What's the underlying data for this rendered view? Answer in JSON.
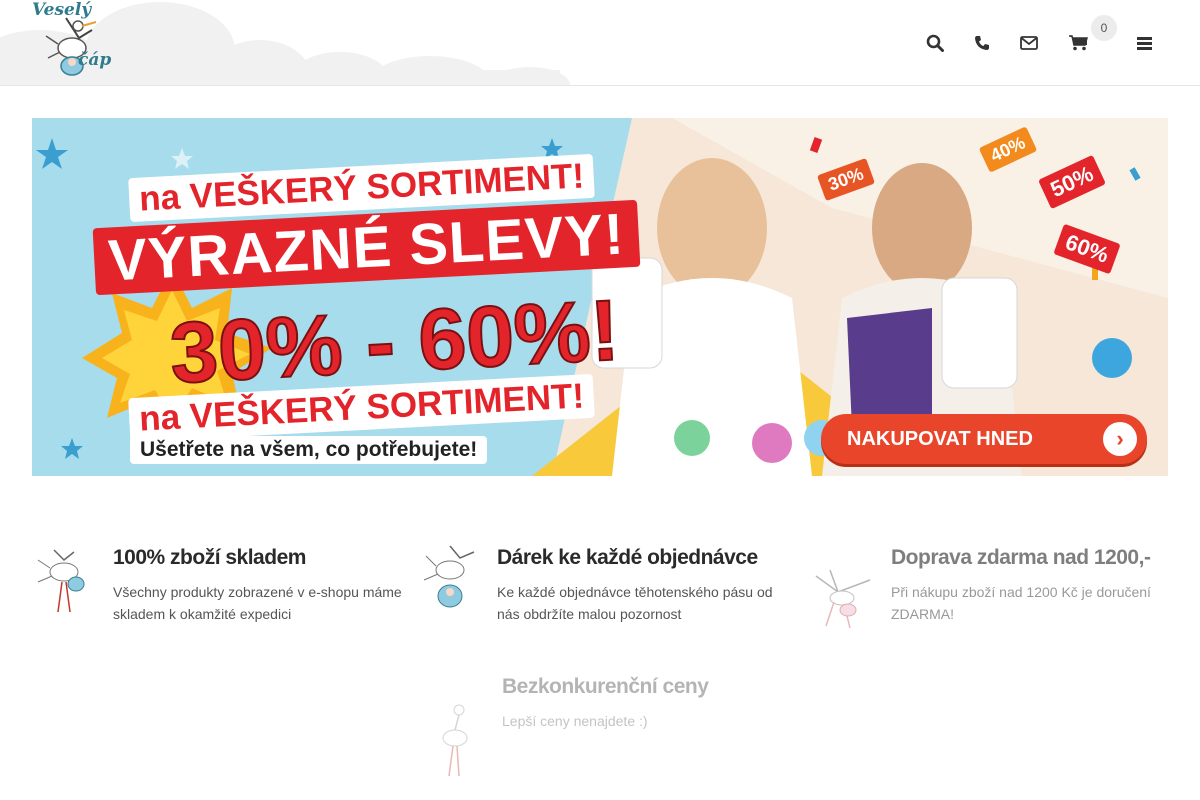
{
  "header": {
    "logo_text_top": "Veselý",
    "logo_text_bottom": "čáp",
    "cart_count": "0",
    "icons": [
      "search-icon",
      "phone-icon",
      "envelope-icon",
      "cart-icon",
      "menu-icon"
    ]
  },
  "banner": {
    "line1": "na VEŠKERÝ SORTIMENT!",
    "line2": "VÝRAZNÉ SLEVY!",
    "line3": "30% - 60%!",
    "line4": "na VEŠKERÝ SORTIMENT!",
    "subline": "Ušetřete na všem, co potřebujete!",
    "cta_label": "NAKUPOVAT HNED",
    "badges": [
      "30%",
      "40%",
      "50%",
      "60%"
    ]
  },
  "features": [
    {
      "title": "100% zboží skladem",
      "text": "Všechny produkty zobrazené v e-shopu máme skladem k okamžité expedici"
    },
    {
      "title": "Dárek ke každé objednávce",
      "text": "Ke každé objednávce těhotenského pásu od nás obdržíte malou pozornost"
    },
    {
      "title": "Doprava zdarma nad 1200,-",
      "text": "Při nákupu zboží nad 1200 Kč je doručení ZDARMA!"
    },
    {
      "title": "Bezkonkurenční ceny",
      "text": "Lepší ceny nenajdete :)"
    }
  ],
  "colors": {
    "accent_red": "#e3242b",
    "cta_orange": "#e8452a",
    "logo_teal": "#2f7a8c"
  }
}
